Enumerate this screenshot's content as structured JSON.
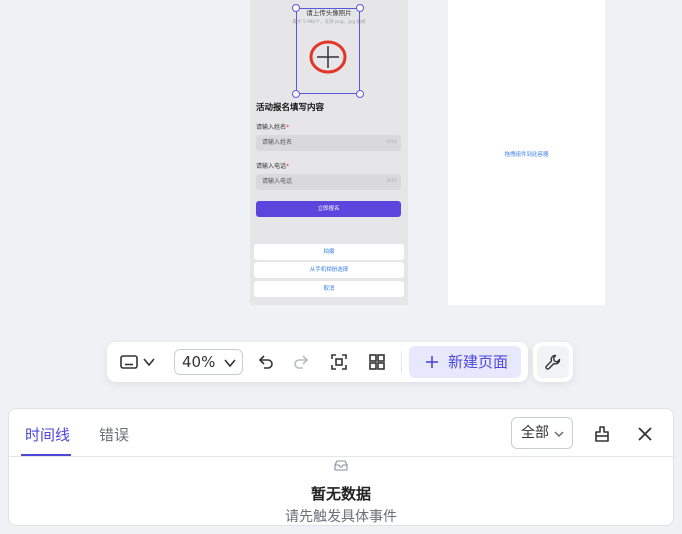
{
  "canvas": {
    "phone": {
      "upload_title": "请上传头像照片",
      "upload_hint": "最大 5 MB/个，支持 png、jpg 格式",
      "form_heading": "活动报名填写内容",
      "name_label": "请输入姓名",
      "name_placeholder": "请输入姓名",
      "name_count": "0/10",
      "phone_label": "请输入电话",
      "phone_placeholder": "请输入电话",
      "phone_count": "0/11",
      "submit_label": "立即报名",
      "sheet": {
        "take_photo": "拍摄",
        "choose_album": "从手机相册选择",
        "cancel": "取消"
      }
    },
    "container": {
      "hint": "拖拽组件到此容器"
    }
  },
  "toolbar": {
    "device_icon": "device-preview-icon",
    "zoom": "40%",
    "undo_icon": "undo-icon",
    "redo_icon": "redo-icon",
    "fit_icon": "fit-screen-icon",
    "grid_icon": "layout-grid-icon",
    "new_page_label": "新建页面",
    "tools_icon": "wrench-icon"
  },
  "bottom_panel": {
    "tabs": [
      {
        "label": "时间线",
        "active": true
      },
      {
        "label": "错误",
        "active": false
      }
    ],
    "filter": "全部",
    "empty_title": "暂无数据",
    "empty_subtitle": "请先触发具体事件"
  },
  "colors": {
    "accent": "#4d47d8",
    "accent_light": "#e8e8fd",
    "submit_button": "#5b45dd",
    "link_blue": "#3b7ee8",
    "highlight_circle": "#e03527",
    "background": "#f0f1f5"
  }
}
